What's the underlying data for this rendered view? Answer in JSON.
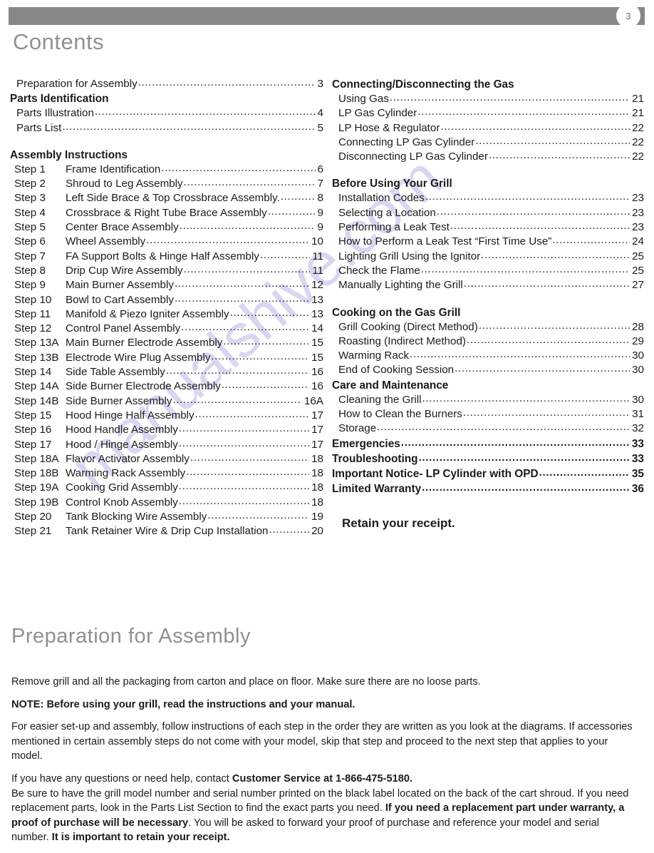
{
  "page": {
    "number": "3",
    "header_bar_color": "#878787",
    "heading_color": "#918f92"
  },
  "watermark": {
    "text": "manualshive.com",
    "color": "#b9b7e8"
  },
  "contents": {
    "title": "Contents",
    "left_column": [
      {
        "kind": "item",
        "label": "Preparation for Assembly",
        "page": "3"
      },
      {
        "kind": "header",
        "label": "Parts Identification",
        "page": ""
      },
      {
        "kind": "item",
        "label": "Parts Illustration",
        "page": "4"
      },
      {
        "kind": "item",
        "label": "Parts List",
        "page": "5"
      },
      {
        "kind": "gap"
      },
      {
        "kind": "header",
        "label": "Assembly Instructions",
        "page": ""
      },
      {
        "kind": "step",
        "step": "Step 1",
        "label": "Frame Identification",
        "page": "6"
      },
      {
        "kind": "step",
        "step": "Step 2",
        "label": "Shroud to Leg Assembly",
        "page": "7"
      },
      {
        "kind": "step",
        "step": "Step 3",
        "label": "Left Side Brace & Top Crossbrace Assembly.",
        "page": "8"
      },
      {
        "kind": "step",
        "step": "Step 4",
        "label": "Crossbrace & Right Tube Brace Assembly",
        "page": "9"
      },
      {
        "kind": "step",
        "step": "Step 5",
        "label": "Center Brace Assembly",
        "page": "9"
      },
      {
        "kind": "step",
        "step": "Step 6",
        "label": "Wheel Assembly",
        "page": "10"
      },
      {
        "kind": "step",
        "step": "Step 7",
        "label": "FA Support Bolts & Hinge Half Assembly",
        "page": "11"
      },
      {
        "kind": "step",
        "step": "Step 8",
        "label": "Drip Cup Wire Assembly",
        "page": "11"
      },
      {
        "kind": "step",
        "step": "Step 9",
        "label": "Main Burner Assembly",
        "page": "12"
      },
      {
        "kind": "step",
        "step": "Step 10",
        "label": "Bowl to Cart Assembly",
        "page": "13"
      },
      {
        "kind": "step",
        "step": "Step 11",
        "label": "Manifold & Piezo Igniter Assembly",
        "page": "13"
      },
      {
        "kind": "step",
        "step": "Step 12",
        "label": "Control Panel Assembly",
        "page": "14"
      },
      {
        "kind": "step",
        "step": "Step 13A",
        "label": "Main Burner Electrode Assembly",
        "page": "15"
      },
      {
        "kind": "step",
        "step": "Step 13B",
        "label": "Electrode Wire Plug Assembly",
        "page": "15"
      },
      {
        "kind": "step",
        "step": "Step 14",
        "label": "Side Table Assembly",
        "page": "16"
      },
      {
        "kind": "step",
        "step": "Step 14A",
        "label": "Side Burner Electrode Assembly",
        "page": "16"
      },
      {
        "kind": "step",
        "step": "Step 14B",
        "label": "Side Burner Assembly",
        "page": "16A"
      },
      {
        "kind": "step",
        "step": "Step 15",
        "label": "Hood Hinge Half Assembly",
        "page": "17"
      },
      {
        "kind": "step",
        "step": "Step 16",
        "label": "Hood Handle Assembly",
        "page": "17"
      },
      {
        "kind": "step",
        "step": "Step 17",
        "label": "Hood / Hinge Assembly",
        "page": "17"
      },
      {
        "kind": "step",
        "step": "Step 18A",
        "label": "Flavor Activator Assembly",
        "page": "18"
      },
      {
        "kind": "step",
        "step": "Step 18B",
        "label": "Warming Rack Assembly",
        "page": "18"
      },
      {
        "kind": "step",
        "step": "Step 19A",
        "label": "Cooking Grid Assembly",
        "page": "18"
      },
      {
        "kind": "step",
        "step": "Step 19B",
        "label": "Control Knob Assembly",
        "page": "18"
      },
      {
        "kind": "step",
        "step": "Step 20",
        "label": "Tank Blocking Wire Assembly",
        "page": "19"
      },
      {
        "kind": "step",
        "step": "Step 21",
        "label": "Tank Retainer Wire & Drip Cup Installation",
        "page": "20"
      }
    ],
    "right_column": [
      {
        "kind": "header",
        "label": "Connecting/Disconnecting the Gas",
        "page": ""
      },
      {
        "kind": "item",
        "label": "Using Gas",
        "page": "21"
      },
      {
        "kind": "item",
        "label": "LP Gas Cylinder",
        "page": "21"
      },
      {
        "kind": "item",
        "label": "LP Hose & Regulator",
        "page": "22"
      },
      {
        "kind": "item",
        "label": "Connecting LP Gas Cylinder",
        "page": "22"
      },
      {
        "kind": "item",
        "label": "Disconnecting LP Gas Cylinder",
        "page": "22"
      },
      {
        "kind": "gap"
      },
      {
        "kind": "header",
        "label": "Before Using Your Grill",
        "page": ""
      },
      {
        "kind": "item",
        "label": "Installation Codes",
        "page": "23"
      },
      {
        "kind": "item",
        "label": "Selecting a Location",
        "page": "23"
      },
      {
        "kind": "item",
        "label": "Performing a Leak Test",
        "page": "23"
      },
      {
        "kind": "item",
        "label": "How to Perform a Leak Test “First Time Use”",
        "page": "24"
      },
      {
        "kind": "item",
        "label": "Lighting Grill Using the Ignitor",
        "page": "25"
      },
      {
        "kind": "item",
        "label": "Check the Flame",
        "page": "25"
      },
      {
        "kind": "item",
        "label": "Manually Lighting the Grill",
        "page": "27"
      },
      {
        "kind": "gap"
      },
      {
        "kind": "header",
        "label": "Cooking on the Gas Grill",
        "page": ""
      },
      {
        "kind": "item",
        "label": "Grill Cooking (Direct Method)",
        "page": "28"
      },
      {
        "kind": "item",
        "label": "Roasting (Indirect Method)",
        "page": "29"
      },
      {
        "kind": "item",
        "label": "Warming Rack",
        "page": "30"
      },
      {
        "kind": "item",
        "label": "End of Cooking Session",
        "page": "30"
      },
      {
        "kind": "header",
        "label": "Care and Maintenance",
        "page": ""
      },
      {
        "kind": "item",
        "label": "Cleaning the Grill",
        "page": "30"
      },
      {
        "kind": "item",
        "label": "How to Clean the Burners",
        "page": "31"
      },
      {
        "kind": "item",
        "label": "Storage",
        "page": "32"
      },
      {
        "kind": "header",
        "label": "Emergencies",
        "page": "33"
      },
      {
        "kind": "header",
        "label": "Troubleshooting",
        "page": "33"
      },
      {
        "kind": "header",
        "label": "Important Notice- LP Cylinder with OPD",
        "page": "35"
      },
      {
        "kind": "header",
        "label": "Limited Warranty",
        "page": "36"
      }
    ],
    "retain_receipt": "Retain your receipt."
  },
  "preparation": {
    "title": "Preparation for Assembly",
    "paragraphs": [
      {
        "id": "p1",
        "runs": [
          {
            "text": "Remove grill and all the packaging from carton and place on floor. Make sure there are no loose parts.",
            "bold": false
          }
        ]
      },
      {
        "id": "p2",
        "runs": [
          {
            "text": "NOTE: Before using your grill, read the instructions and your manual.",
            "bold": true
          }
        ]
      },
      {
        "id": "p3",
        "runs": [
          {
            "text": "For easier set-up and assembly, follow instructions of each step in the order they are written as you look at the diagrams. If accessories mentioned in certain assembly steps do not come with your model, skip that step and proceed to the next step that applies to your model.",
            "bold": false
          }
        ]
      },
      {
        "id": "p4",
        "runs": [
          {
            "text": "If you have any questions or need help,  contact ",
            "bold": false
          },
          {
            "text": "Customer Service at 1-866-475-5180.",
            "bold": true
          }
        ]
      },
      {
        "id": "p5",
        "runs": [
          {
            "text": "Be sure to have the grill model number and serial number printed on the black label located on the back of the cart shroud. If you need replacement parts, look in the Parts List Section to find the exact parts you need. ",
            "bold": false
          },
          {
            "text": "If you need a replacement part under warranty, a proof of purchase will be necessary",
            "bold": true
          },
          {
            "text": ". You will be asked to forward your proof of purchase and reference your model and serial number. ",
            "bold": false
          },
          {
            "text": "It is important to retain your receipt.",
            "bold": true
          }
        ]
      }
    ]
  }
}
